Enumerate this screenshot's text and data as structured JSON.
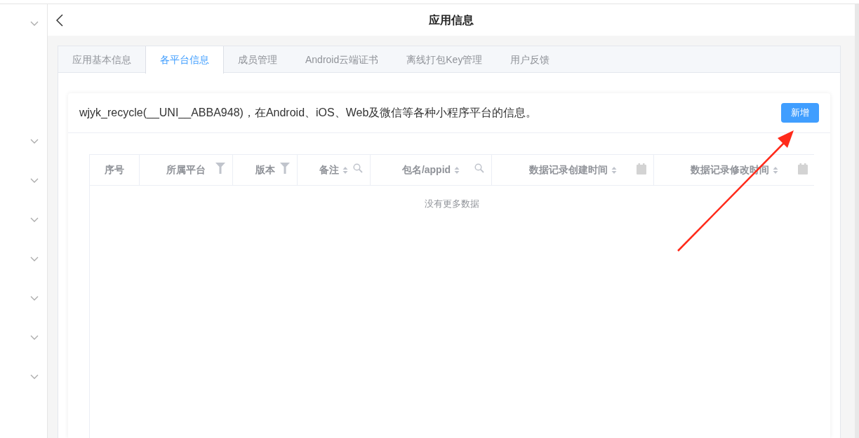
{
  "header": {
    "title": "应用信息"
  },
  "tabs": [
    {
      "label": "应用基本信息",
      "selected": false
    },
    {
      "label": "各平台信息",
      "selected": true
    },
    {
      "label": "成员管理",
      "selected": false
    },
    {
      "label": "Android云端证书",
      "selected": false
    },
    {
      "label": "离线打包Key管理",
      "selected": false
    },
    {
      "label": "用户反馈",
      "selected": false
    }
  ],
  "card": {
    "description": "wjyk_recycle(__UNI__ABBA948)，在Android、iOS、Web及微信等各种小程序平台的信息。",
    "add_button": "新增"
  },
  "table": {
    "columns": [
      {
        "label": "序号",
        "sortable": false,
        "kind": "plain"
      },
      {
        "label": "所属平台",
        "sortable": false,
        "kind": "filter"
      },
      {
        "label": "版本",
        "sortable": false,
        "kind": "filter"
      },
      {
        "label": "备注",
        "sortable": true,
        "kind": "search"
      },
      {
        "label": "包名/appid",
        "sortable": true,
        "kind": "search"
      },
      {
        "label": "数据记录创建时间",
        "sortable": true,
        "kind": "date"
      },
      {
        "label": "数据记录修改时间",
        "sortable": true,
        "kind": "date"
      }
    ],
    "empty_text": "没有更多数据"
  }
}
